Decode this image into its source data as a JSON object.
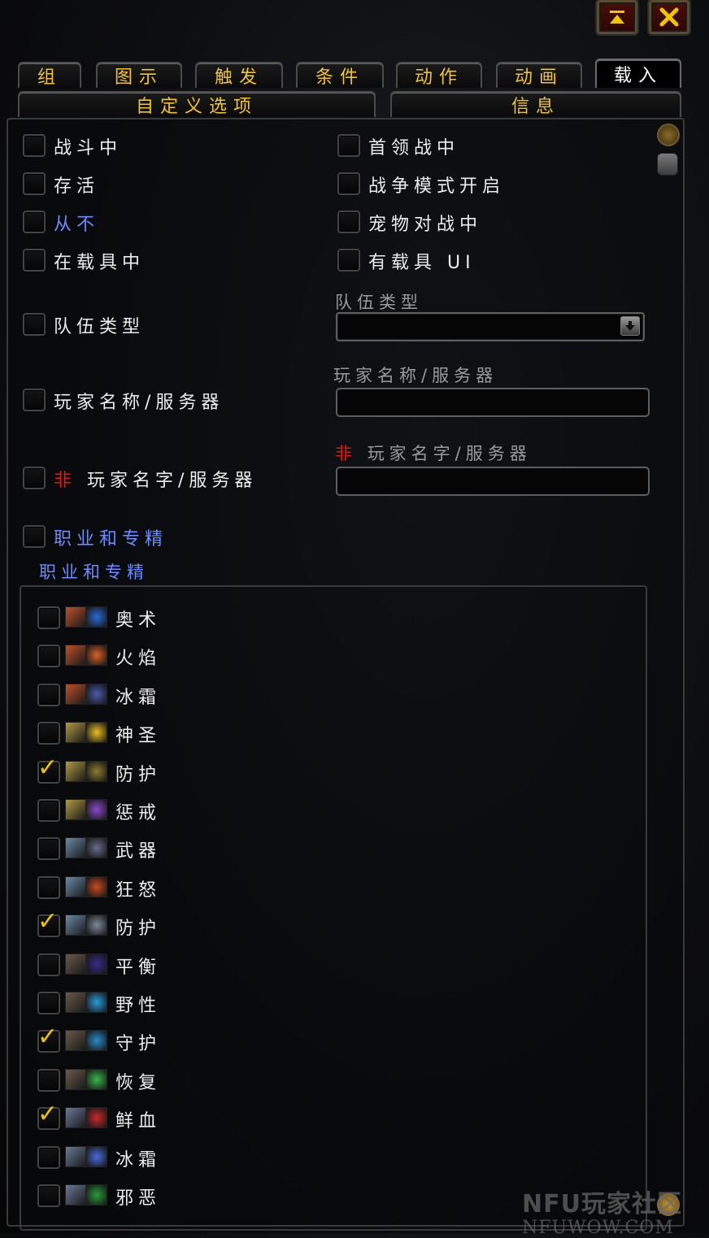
{
  "window": {
    "collapse_icon": "collapse-icon",
    "close_icon": "close-icon"
  },
  "tabs": {
    "row1": [
      {
        "label": "组"
      },
      {
        "label": "图示"
      },
      {
        "label": "触发"
      },
      {
        "label": "条件"
      },
      {
        "label": "动作"
      },
      {
        "label": "动画"
      },
      {
        "label": "载入",
        "active": true
      }
    ],
    "row2": [
      {
        "label": "自定义选项"
      },
      {
        "label": "信息"
      }
    ]
  },
  "options": {
    "left": [
      {
        "label": "战斗中"
      },
      {
        "label": "存活"
      },
      {
        "label": "从不",
        "blue": true
      },
      {
        "label": "在载具中"
      },
      {
        "label": "队伍类型"
      },
      {
        "label": "玩家名称/服务器"
      },
      {
        "label_prefix": "非",
        "label": "玩家名字/服务器"
      },
      {
        "label": "职业和专精",
        "blue": true
      }
    ],
    "right": [
      {
        "label": "首领战中"
      },
      {
        "label": "战争模式开启"
      },
      {
        "label": "宠物对战中"
      },
      {
        "label": "有载具 UI"
      }
    ]
  },
  "fields": {
    "group_type_label": "队伍类型",
    "group_type_value": "",
    "player_name_label": "玩家名称/服务器",
    "player_name_value": "",
    "not_prefix": "非",
    "not_player_name_label": "玩家名字/服务器",
    "not_player_name_value": ""
  },
  "class_spec": {
    "heading": "职业和专精",
    "items": [
      {
        "label": "奥术",
        "checked": false,
        "class_icon": "mage-icon",
        "spec_icon": "arcane-icon",
        "class_color": "#c0502a",
        "spec_color": "#2a6ad8"
      },
      {
        "label": "火焰",
        "checked": false,
        "class_icon": "mage-icon",
        "spec_icon": "fire-icon",
        "class_color": "#c0502a",
        "spec_color": "#d8602a"
      },
      {
        "label": "冰霜",
        "checked": false,
        "class_icon": "mage-icon",
        "spec_icon": "frost-icon",
        "class_color": "#c0502a",
        "spec_color": "#4a5aa8"
      },
      {
        "label": "神圣",
        "checked": false,
        "class_icon": "paladin-icon",
        "spec_icon": "holy-icon",
        "class_color": "#b09a40",
        "spec_color": "#e8c020"
      },
      {
        "label": "防护",
        "checked": true,
        "class_icon": "paladin-icon",
        "spec_icon": "protection-icon",
        "class_color": "#b09a40",
        "spec_color": "#8a7a30"
      },
      {
        "label": "惩戒",
        "checked": false,
        "class_icon": "paladin-icon",
        "spec_icon": "retribution-icon",
        "class_color": "#b09a40",
        "spec_color": "#8a4ac8"
      },
      {
        "label": "武器",
        "checked": false,
        "class_icon": "warrior-icon",
        "spec_icon": "arms-icon",
        "class_color": "#6a8aa8",
        "spec_color": "#6a6a8a"
      },
      {
        "label": "狂怒",
        "checked": false,
        "class_icon": "warrior-icon",
        "spec_icon": "fury-icon",
        "class_color": "#6a8aa8",
        "spec_color": "#c84a20"
      },
      {
        "label": "防护",
        "checked": true,
        "class_icon": "warrior-icon",
        "spec_icon": "shield-icon",
        "class_color": "#6a8aa8",
        "spec_color": "#7a8a9a"
      },
      {
        "label": "平衡",
        "checked": false,
        "class_icon": "druid-icon",
        "spec_icon": "balance-icon",
        "class_color": "#6a5a4a",
        "spec_color": "#3a2a8a"
      },
      {
        "label": "野性",
        "checked": false,
        "class_icon": "druid-icon",
        "spec_icon": "feral-icon",
        "class_color": "#6a5a4a",
        "spec_color": "#2a9ad8"
      },
      {
        "label": "守护",
        "checked": true,
        "class_icon": "druid-icon",
        "spec_icon": "guardian-icon",
        "class_color": "#6a5a4a",
        "spec_color": "#2a8ac8"
      },
      {
        "label": "恢复",
        "checked": false,
        "class_icon": "druid-icon",
        "spec_icon": "restoration-icon",
        "class_color": "#6a5a4a",
        "spec_color": "#3ab84a"
      },
      {
        "label": "鲜血",
        "checked": true,
        "class_icon": "death-knight-icon",
        "spec_icon": "blood-icon",
        "class_color": "#6a7a9a",
        "spec_color": "#c82a2a"
      },
      {
        "label": "冰霜",
        "checked": false,
        "class_icon": "death-knight-icon",
        "spec_icon": "frost-dk-icon",
        "class_color": "#6a7a9a",
        "spec_color": "#4a6ad8"
      },
      {
        "label": "邪恶",
        "checked": false,
        "class_icon": "death-knight-icon",
        "spec_icon": "unholy-icon",
        "class_color": "#6a7a9a",
        "spec_color": "#2a9a3a"
      }
    ]
  },
  "watermark": {
    "line1": "NFU玩家社区",
    "line2": "NFUWOW.COM"
  }
}
